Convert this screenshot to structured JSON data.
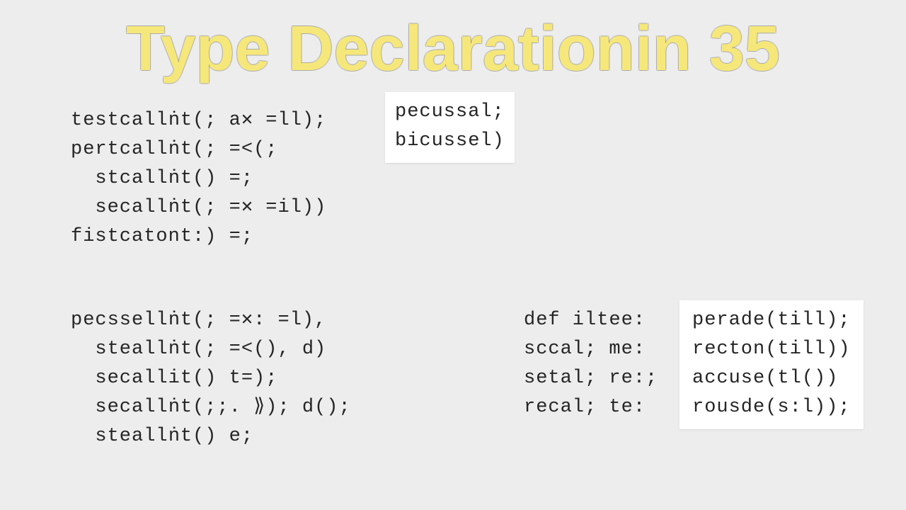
{
  "title": "Type Declarationin 35",
  "top_left": "testcallṅt(; a✕ =ll);\npertcallṅt(; =<(;\n  stcallṅt() =;\n  secallṅt(; =✕ =il))\nfistcatont:) =;",
  "top_right": "pecussal;\nbicussel)",
  "bottom_left": "pecssellṅt(; =✕: =l),\n  steallṅt(; =<(), d)\n  secallit() t=);\n  secallṅt(;;. ⟫); d();\n  steallṅt() e;",
  "def_block": "def iltee:\nsccal; me:\nsetal; re:;\nrecal; te:",
  "bottom_right": "perade(till);\nrecton(till))\naccuse(tl())\nrousde(s:l));"
}
